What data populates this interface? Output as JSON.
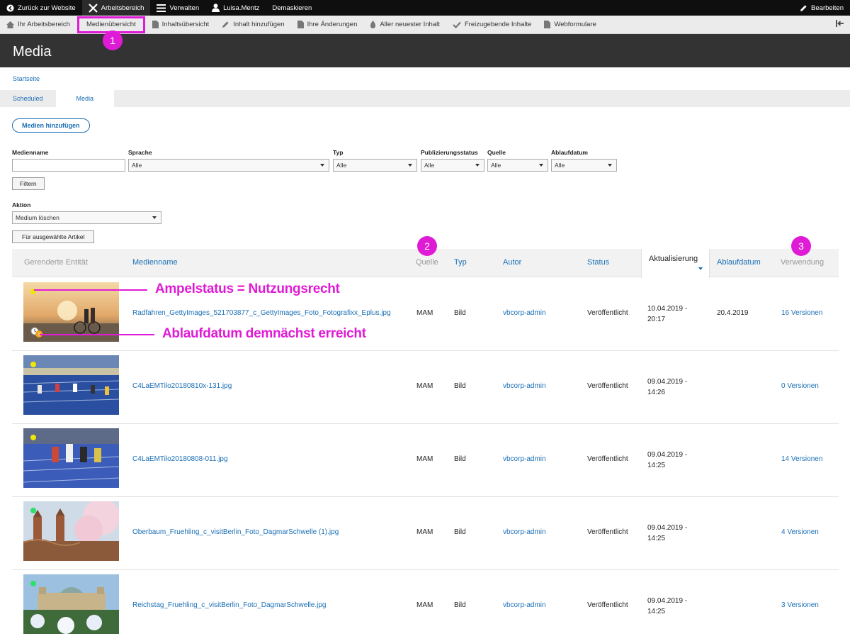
{
  "toolbar": {
    "back": "Zurück zur Website",
    "workspace": "Arbeitsbereich",
    "manage": "Verwalten",
    "user": "Luisa.Mentz",
    "unmask": "Demaskieren",
    "edit": "Bearbeiten"
  },
  "subtoolbar": {
    "items": [
      "Ihr Arbeitsbereich",
      "Medienübersicht",
      "Inhaltsübersicht",
      "Inhalt hinzufügen",
      "Ihre Änderungen",
      "Aller neuester Inhalt",
      "Freizugebende Inhalte",
      "Webformulare"
    ]
  },
  "page": {
    "title": "Media",
    "breadcrumb": "Startseite",
    "tabs": [
      "Scheduled",
      "Media"
    ]
  },
  "add_media": "Medien hinzufügen",
  "filters": {
    "name_label": "Medienname",
    "language_label": "Sprache",
    "language_value": "Alle",
    "type_label": "Typ",
    "type_value": "Alle",
    "pubstatus_label": "Publizierungsstatus",
    "pubstatus_value": "Alle",
    "source_label": "Quelle",
    "source_value": "Alle",
    "expiry_label": "Ablaufdatum",
    "expiry_value": "Alle",
    "filter_button": "Filtern"
  },
  "action": {
    "label": "Aktion",
    "value": "Medium löschen",
    "button": "Für ausgewählte Artikel"
  },
  "table": {
    "headers": [
      "Gerenderte Entität",
      "Medienname",
      "Quelle",
      "Typ",
      "Autor",
      "Status",
      "Aktualisierung",
      "Ablaufdatum",
      "Verwendung"
    ],
    "rows": [
      {
        "name": "Radfahren_GettyImages_521703877_c_GettyImages_Foto_Fotografixx_Eplus.jpg",
        "source": "MAM",
        "type": "Bild",
        "author": "vbcorp-admin",
        "status": "Veröffentlicht",
        "updated_date": "10.04.2019 -",
        "updated_time": "20:17",
        "expiry": "20.4.2019",
        "usage": "16 Versionen",
        "light": "#f0e60a"
      },
      {
        "name": "C4LaEMTilo20180810x-131.jpg",
        "source": "MAM",
        "type": "Bild",
        "author": "vbcorp-admin",
        "status": "Veröffentlicht",
        "updated_date": "09.04.2019 -",
        "updated_time": "14:26",
        "expiry": "",
        "usage": "0 Versionen",
        "light": "#f0e60a"
      },
      {
        "name": "C4LaEMTilo20180808-011.jpg",
        "source": "MAM",
        "type": "Bild",
        "author": "vbcorp-admin",
        "status": "Veröffentlicht",
        "updated_date": "09.04.2019 -",
        "updated_time": "14:25",
        "expiry": "",
        "usage": "14 Versionen",
        "light": "#f0e60a"
      },
      {
        "name": "Oberbaum_Fruehling_c_visitBerlin_Foto_DagmarSchwelle (1).jpg",
        "source": "MAM",
        "type": "Bild",
        "author": "vbcorp-admin",
        "status": "Veröffentlicht",
        "updated_date": "09.04.2019 -",
        "updated_time": "14:25",
        "expiry": "",
        "usage": "4 Versionen",
        "light": "#2ee06a"
      },
      {
        "name": "Reichstag_Fruehling_c_visitBerlin_Foto_DagmarSchwelle.jpg",
        "source": "MAM",
        "type": "Bild",
        "author": "vbcorp-admin",
        "status": "Veröffentlicht",
        "updated_date": "09.04.2019 -",
        "updated_time": "14:25",
        "expiry": "",
        "usage": "3 Versionen",
        "light": "#2ee06a"
      }
    ]
  },
  "annotations": {
    "num1": "1",
    "num2": "2",
    "num3": "3",
    "traffic": "Ampelstatus = Nutzungsrecht",
    "expiry": "Ablaufdatum demnächst erreicht"
  },
  "colors": {
    "accent": "#e01bd6",
    "link": "#1a6fb5",
    "toolbar": "#0f0f0f",
    "header": "#333333"
  }
}
